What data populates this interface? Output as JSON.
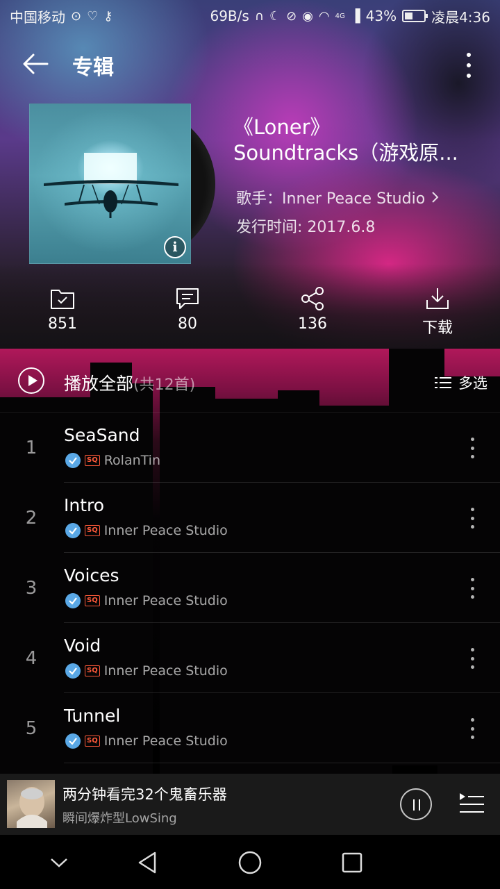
{
  "status_bar": {
    "carrier": "中国移动",
    "net_speed": "69B/s",
    "signal_label": "4G",
    "battery_percent": "43%",
    "battery_level": 0.43,
    "time": "凌晨4:36"
  },
  "appbar": {
    "title": "专辑"
  },
  "album": {
    "title_line1": "《Loner》",
    "title_line2": "Soundtracks（游戏原...",
    "artist_label": "歌手：",
    "artist": "Inner Peace Studio",
    "release_label": "发行时间: ",
    "release_date": "2017.6.8"
  },
  "actions": {
    "collect_count": "851",
    "comment_count": "80",
    "share_count": "136",
    "download_label": "下载"
  },
  "playall": {
    "label": "播放全部",
    "count": "(共12首)",
    "multi_select": "多选"
  },
  "songs": [
    {
      "index": "1",
      "title": "SeaSand",
      "quality": "SQ",
      "artist": "RolanTin"
    },
    {
      "index": "2",
      "title": "Intro",
      "quality": "SQ",
      "artist": "Inner Peace Studio"
    },
    {
      "index": "3",
      "title": "Voices",
      "quality": "SQ",
      "artist": "Inner Peace Studio"
    },
    {
      "index": "4",
      "title": "Void",
      "quality": "SQ",
      "artist": "Inner Peace Studio"
    },
    {
      "index": "5",
      "title": "Tunnel",
      "quality": "SQ",
      "artist": "Inner Peace Studio"
    }
  ],
  "mini_player": {
    "title": "两分钟看完32个鬼畜乐器",
    "subtitle": "瞬间爆炸型LowSing"
  },
  "colors": {
    "accent_check": "#5aa8e6",
    "sq_badge": "#ff5a3a",
    "hero_pink": "#e6288c",
    "hero_purple": "#5a3a8a"
  },
  "icons": {
    "back": "arrow-left-icon",
    "more": "more-vertical-icon",
    "info": "info-icon",
    "collect": "folder-check-icon",
    "comment": "comment-icon",
    "share": "share-icon",
    "download": "download-icon",
    "play_all": "play-circle-icon",
    "multi_select": "list-icon",
    "verified": "check-circle-icon",
    "pause": "pause-icon",
    "queue": "playlist-icon"
  }
}
